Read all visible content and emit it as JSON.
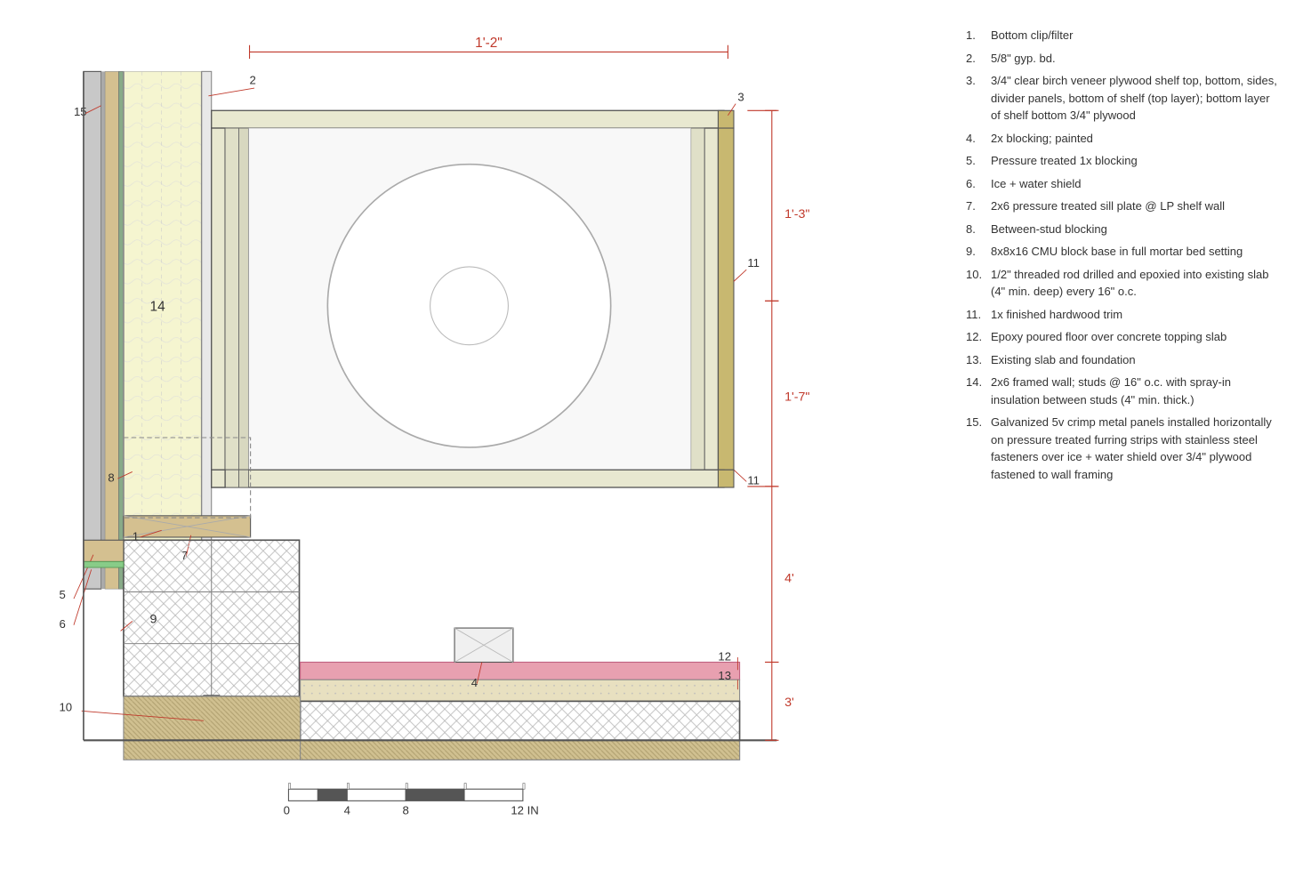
{
  "legend": {
    "items": [
      {
        "num": "1.",
        "text": "Bottom clip/filter"
      },
      {
        "num": "2.",
        "text": "5/8\" gyp. bd."
      },
      {
        "num": "3.",
        "text": "3/4\" clear birch veneer plywood shelf top, bottom, sides, divider panels, bottom of shelf (top layer); bottom layer of shelf bottom 3/4\" plywood"
      },
      {
        "num": "4.",
        "text": "2x blocking; painted"
      },
      {
        "num": "5.",
        "text": "Pressure treated 1x blocking"
      },
      {
        "num": "6.",
        "text": "Ice + water shield"
      },
      {
        "num": "7.",
        "text": "2x6 pressure treated sill plate @ LP shelf wall"
      },
      {
        "num": "8.",
        "text": "Between-stud blocking"
      },
      {
        "num": "9.",
        "text": "8x8x16 CMU block base in full mortar bed setting"
      },
      {
        "num": "10.",
        "text": "1/2\" threaded rod drilled and epoxied into existing slab (4\" min. deep) every 16\" o.c."
      },
      {
        "num": "11.",
        "text": "1x finished hardwood trim"
      },
      {
        "num": "12.",
        "text": "Epoxy poured floor over concrete topping slab"
      },
      {
        "num": "13.",
        "text": "Existing slab and foundation"
      },
      {
        "num": "14.",
        "text": "2x6 framed wall; studs @ 16\" o.c. with spray-in insulation between studs (4\" min. thick.)"
      },
      {
        "num": "15.",
        "text": "Galvanized 5v crimp metal panels installed horizontally on pressure treated furring strips with stainless steel fasteners over ice + water shield over 3/4\" plywood fastened to wall framing"
      }
    ]
  },
  "dimensions": {
    "top": "1'-2\"",
    "right_top": "1'-3\"",
    "right_mid": "1'-7\"",
    "right_bot": "4'",
    "right_far": "3'",
    "scale": "0  4  8  12 IN"
  }
}
